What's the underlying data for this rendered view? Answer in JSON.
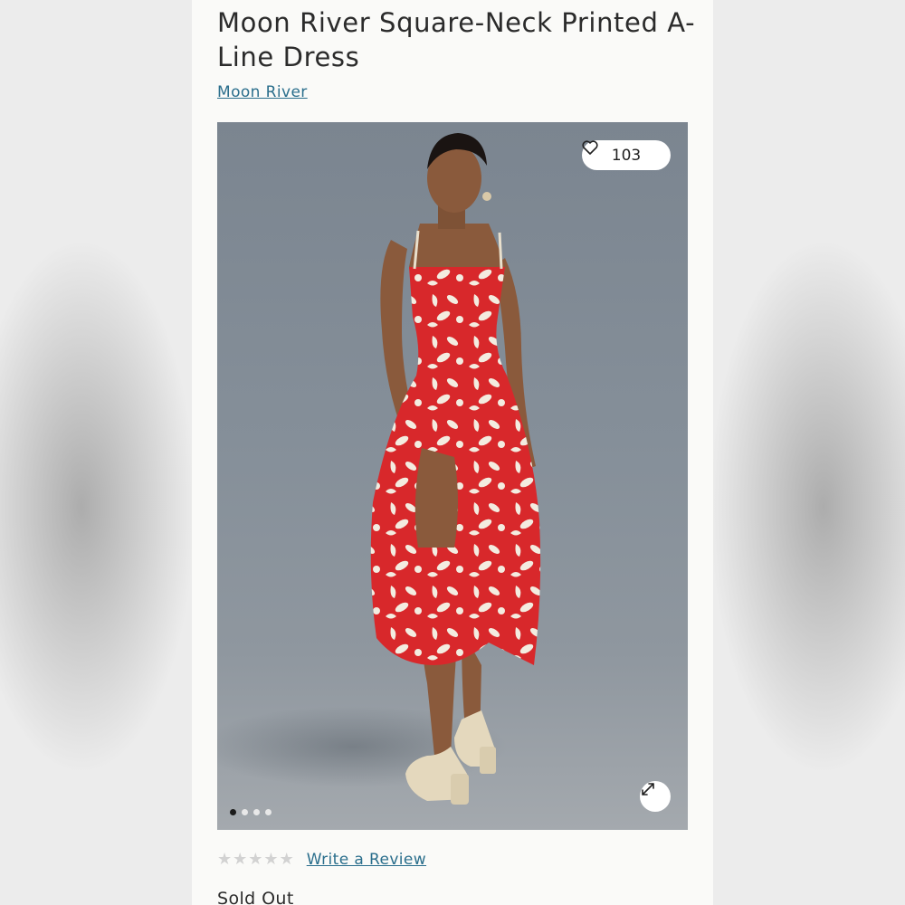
{
  "product": {
    "title": "Moon River Square-Neck Printed A-Line Dress",
    "brand": "Moon River"
  },
  "gallery": {
    "like_count": "103",
    "like_icon": "heart-icon",
    "expand_icon": "expand-icon",
    "image_count": 4,
    "active_index": 0,
    "dress_color": "#d8282b",
    "print_color": "#f3ece0"
  },
  "reviews": {
    "star_rating": 0,
    "star_max": 5,
    "write_review_label": "Write a Review"
  },
  "availability": {
    "status": "Sold Out"
  }
}
